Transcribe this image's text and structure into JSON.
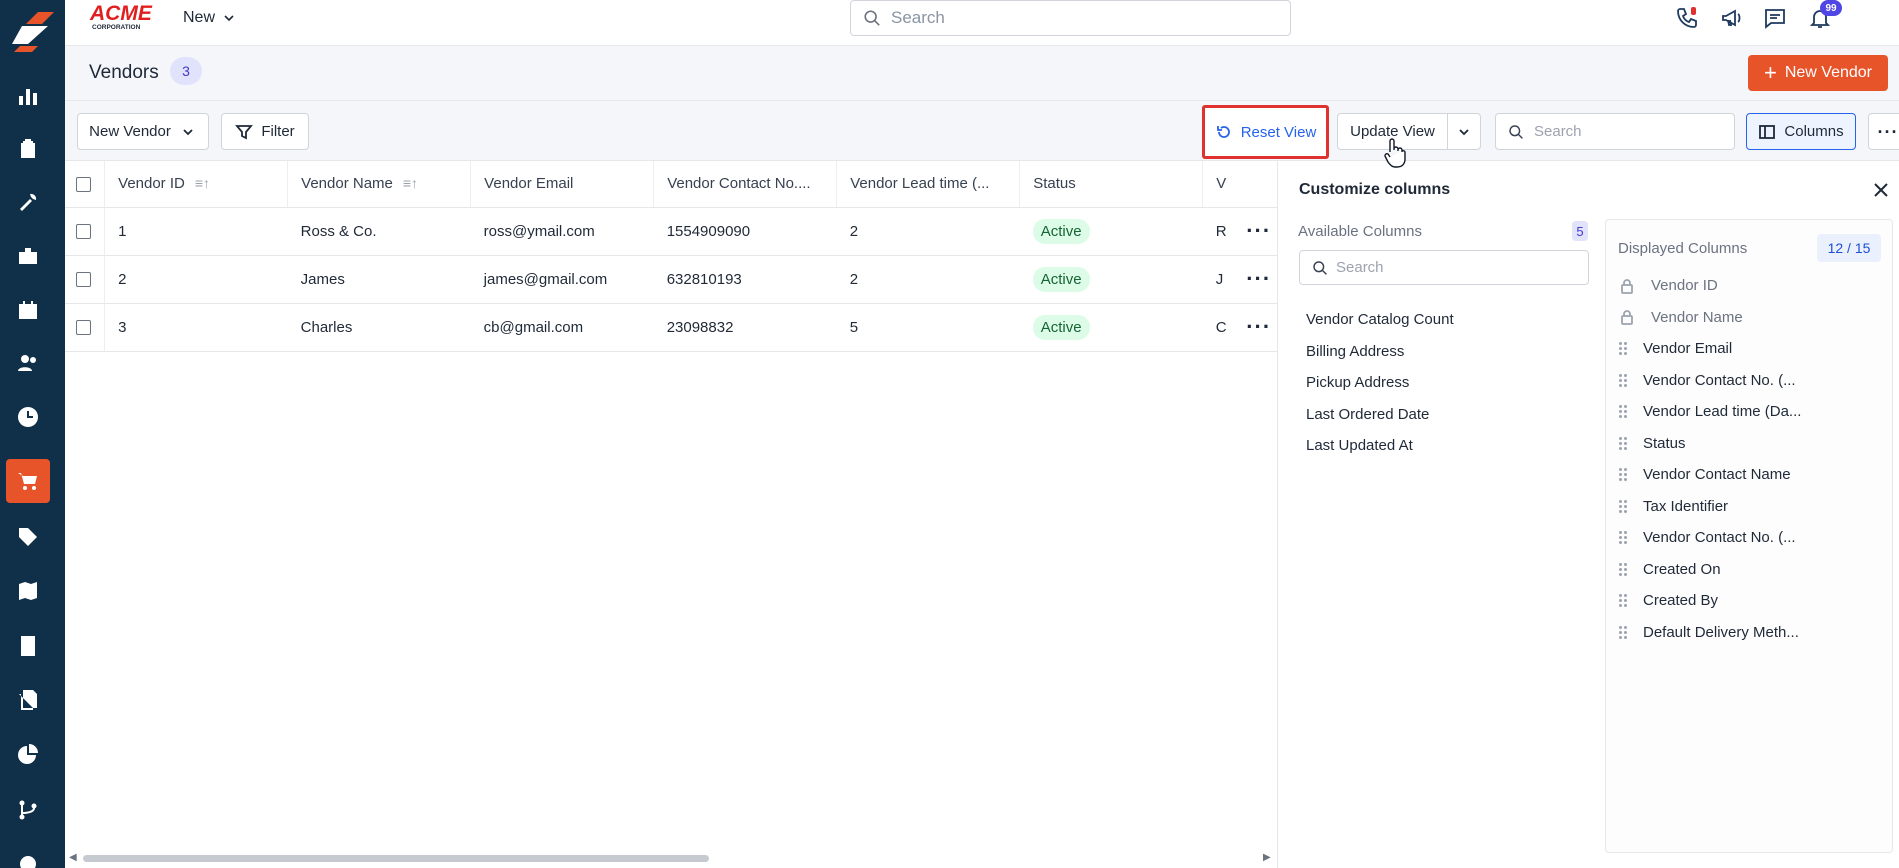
{
  "brand": {
    "name": "ACME",
    "tagline": "CORPORATION"
  },
  "topbar": {
    "new_menu_label": "New",
    "search_placeholder": "Search",
    "notification_count": "99"
  },
  "sidebar": {
    "items": [
      {
        "icon": "dashboard-icon"
      },
      {
        "icon": "clipboard-icon"
      },
      {
        "icon": "tools-icon"
      },
      {
        "icon": "briefcase-icon"
      },
      {
        "icon": "calendar-icon"
      },
      {
        "icon": "users-icon"
      },
      {
        "icon": "clock-icon"
      },
      {
        "icon": "cart-icon",
        "active": true
      },
      {
        "icon": "tag-icon"
      },
      {
        "icon": "map-icon"
      },
      {
        "icon": "calculator-icon"
      },
      {
        "icon": "documents-icon"
      },
      {
        "icon": "pie-chart-icon"
      },
      {
        "icon": "workflow-icon"
      },
      {
        "icon": "settings-icon"
      }
    ]
  },
  "page": {
    "title": "Vendors",
    "count": "3",
    "new_button_label": "New Vendor"
  },
  "toolbar": {
    "view_select_label": "New Vendor",
    "filter_label": "Filter",
    "reset_view_label": "Reset View",
    "update_view_label": "Update View",
    "search_placeholder": "Search",
    "columns_label": "Columns"
  },
  "table": {
    "headers": [
      "Vendor ID",
      "Vendor Name",
      "Vendor Email",
      "Vendor Contact No....",
      "Vendor Lead time (...",
      "Status",
      "V"
    ],
    "rows": [
      {
        "id": "1",
        "name": "Ross & Co.",
        "email": "ross@ymail.com",
        "contact": "1554909090",
        "lead": "2",
        "status": "Active",
        "extra": "R"
      },
      {
        "id": "2",
        "name": "James",
        "email": "james@gmail.com",
        "contact": "632810193",
        "lead": "2",
        "status": "Active",
        "extra": "J"
      },
      {
        "id": "3",
        "name": "Charles",
        "email": "cb@gmail.com",
        "contact": "23098832",
        "lead": "5",
        "status": "Active",
        "extra": "C"
      }
    ]
  },
  "panel": {
    "title": "Customize columns",
    "available_label": "Available Columns",
    "available_count": "5",
    "search_placeholder": "Search",
    "available": [
      "Vendor Catalog Count",
      "Billing Address",
      "Pickup Address",
      "Last Ordered Date",
      "Last Updated At"
    ],
    "displayed_label": "Displayed Columns",
    "displayed_count": "12 / 15",
    "displayed": [
      {
        "label": "Vendor ID",
        "locked": true
      },
      {
        "label": "Vendor Name",
        "locked": true
      },
      {
        "label": "Vendor Email",
        "locked": false
      },
      {
        "label": "Vendor Contact No. (...",
        "locked": false
      },
      {
        "label": "Vendor Lead time (Da...",
        "locked": false
      },
      {
        "label": "Status",
        "locked": false
      },
      {
        "label": "Vendor Contact Name",
        "locked": false
      },
      {
        "label": "Tax Identifier",
        "locked": false
      },
      {
        "label": "Vendor Contact No. (...",
        "locked": false
      },
      {
        "label": "Created On",
        "locked": false
      },
      {
        "label": "Created By",
        "locked": false
      },
      {
        "label": "Default Delivery Meth...",
        "locked": false
      }
    ]
  },
  "colors": {
    "sidebar": "#10304a",
    "accent": "#e8542a",
    "link": "#2563eb",
    "highlight_border": "#e03131"
  }
}
